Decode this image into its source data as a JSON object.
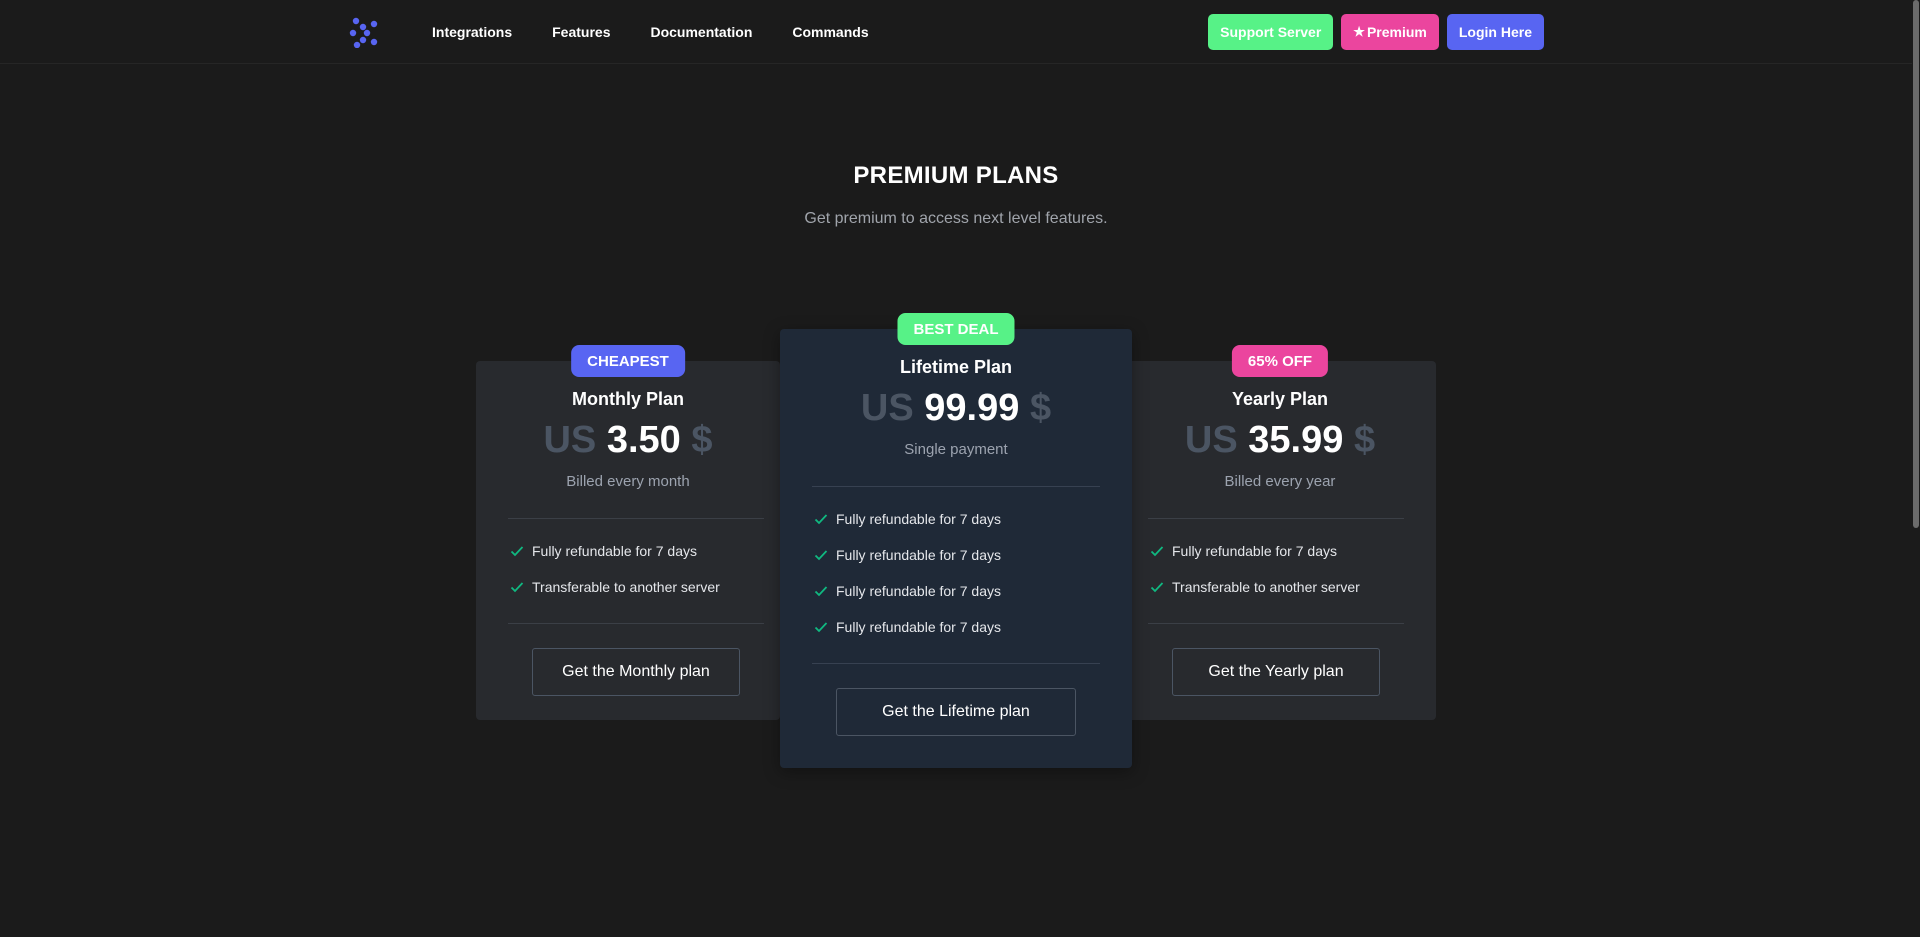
{
  "nav": {
    "links": [
      "Integrations",
      "Features",
      "Documentation",
      "Commands"
    ],
    "support_label": "Support Server",
    "premium_label": "Premium",
    "login_label": "Login Here"
  },
  "header": {
    "title": "PREMIUM PLANS",
    "subtitle": "Get premium to access next level features."
  },
  "plans": [
    {
      "badge": "CHEAPEST",
      "name": "Monthly Plan",
      "currency_prefix": "US",
      "amount": "3.50",
      "currency_suffix": "$",
      "billing": "Billed every month",
      "features": [
        "Fully refundable for 7 days",
        "Transferable to another server"
      ],
      "cta": "Get the Monthly plan"
    },
    {
      "badge": "BEST DEAL",
      "name": "Lifetime Plan",
      "currency_prefix": "US",
      "amount": "99.99",
      "currency_suffix": "$",
      "billing": "Single payment",
      "features": [
        "Fully refundable for 7 days",
        "Fully refundable for 7 days",
        "Fully refundable for 7 days",
        "Fully refundable for 7 days"
      ],
      "cta": "Get the Lifetime plan"
    },
    {
      "badge": "65% OFF",
      "name": "Yearly Plan",
      "currency_prefix": "US",
      "amount": "35.99",
      "currency_suffix": "$",
      "billing": "Billed every year",
      "features": [
        "Fully refundable for 7 days",
        "Transferable to another server"
      ],
      "cta": "Get the Yearly plan"
    }
  ],
  "colors": {
    "background": "#1b1b1b",
    "blurple": "#5865f2",
    "green": "#57f287",
    "pink": "#eb459e",
    "check": "#10b981"
  },
  "icons": {
    "logo": "dots-logo-icon",
    "premium": "star-icon",
    "feature": "check-icon"
  }
}
